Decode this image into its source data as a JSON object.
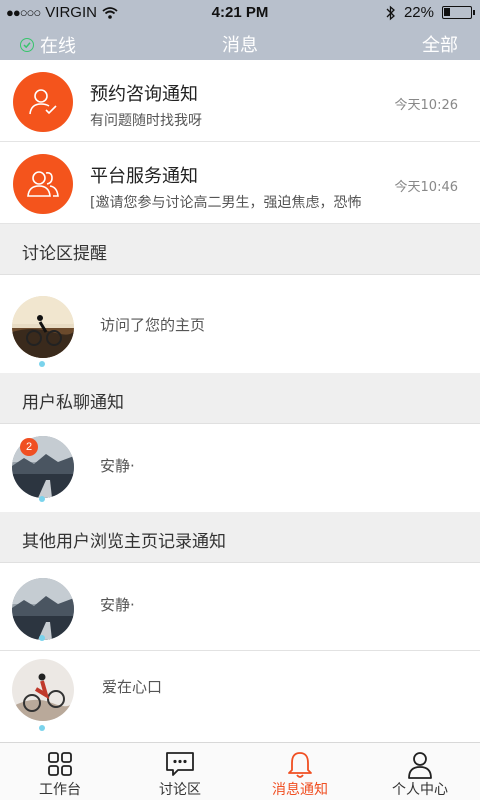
{
  "status_bar": {
    "carrier": "VIRGIN",
    "time": "4:21 PM",
    "battery": "22%",
    "battery_level": 0.22
  },
  "header": {
    "status": "在线",
    "title": "消息",
    "filter": "全部"
  },
  "notices": [
    {
      "title": "预约咨询通知",
      "subtitle": "有问题随时找我呀",
      "time": "今天10:26",
      "icon": "user-check-icon"
    },
    {
      "title": "平台服务通知",
      "subtitle": "[邀请您参与讨论高二男生，强迫焦虑，恐怖",
      "time": "今天10:46",
      "icon": "users-icon"
    }
  ],
  "sections": {
    "forum_reminder": "讨论区提醒",
    "private_chat": "用户私聊通知",
    "browse_records": "其他用户浏览主页记录通知"
  },
  "forum_entries": [
    {
      "text": "访问了您的主页"
    }
  ],
  "chat_entries": [
    {
      "name": "安静·",
      "badge": "2"
    }
  ],
  "browse_entries": [
    {
      "name": "安静·"
    },
    {
      "name": "爱在心口"
    }
  ],
  "tabs": [
    {
      "label": "工作台",
      "icon": "grid-icon"
    },
    {
      "label": "讨论区",
      "icon": "chat-bubble-icon"
    },
    {
      "label": "消息通知",
      "icon": "bell-icon"
    },
    {
      "label": "个人中心",
      "icon": "person-icon"
    }
  ],
  "colors": {
    "accent": "#f04f22",
    "header_bg": "#b8c0cc",
    "online": "#38c46c",
    "section_bg": "#efefef"
  }
}
